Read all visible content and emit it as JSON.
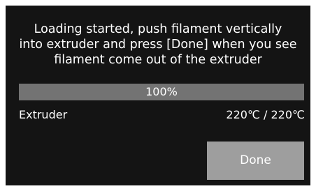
{
  "dialog": {
    "message": "Loading started, push filament vertically\ninto extruder and press [Done] when you see\nfilament come out of the extruder"
  },
  "progress": {
    "label": "100%",
    "fraction": 1.0
  },
  "extruder": {
    "label": "Extruder",
    "temperature": "220℃ / 220℃"
  },
  "actions": {
    "done_label": "Done"
  },
  "colors": {
    "screen_background": "#141414",
    "progress_track": "#5a5a5a",
    "progress_fill": "#737373",
    "button_background": "#9e9e9e",
    "text": "#ffffff"
  }
}
